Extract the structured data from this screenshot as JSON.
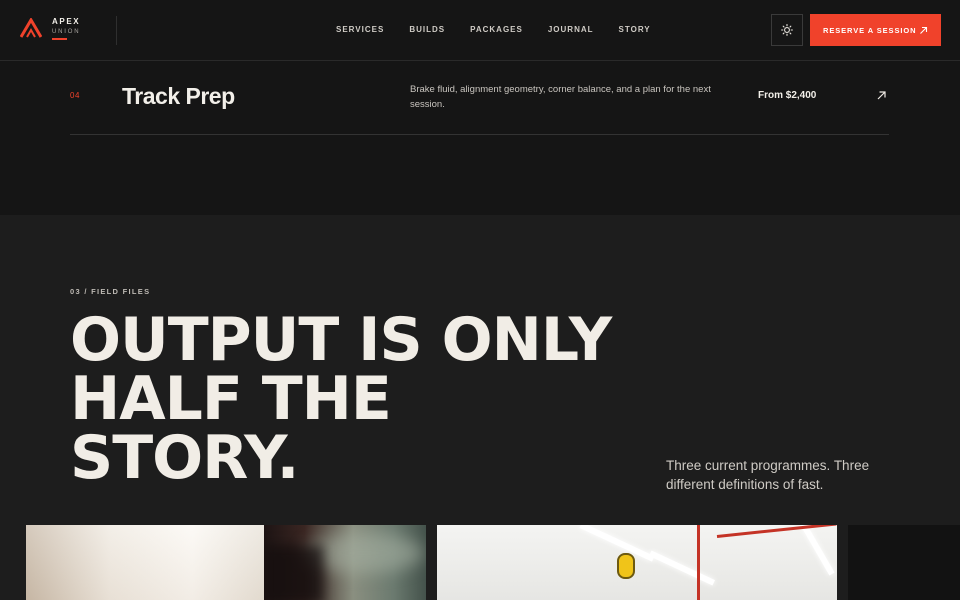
{
  "brand": {
    "name": "APEX",
    "sub": "UNION",
    "accent": "#f0422b"
  },
  "nav": {
    "items": [
      "SERVICES",
      "BUILDS",
      "PACKAGES",
      "JOURNAL",
      "STORY"
    ]
  },
  "header": {
    "theme_icon": "sun-icon",
    "cta_label": "RESERVE A SESSION",
    "cta_icon": "arrow-up-right-icon"
  },
  "service_row": {
    "number": "04",
    "title": "Track Prep",
    "description": "Brake fluid, alignment geometry, corner balance, and a plan for the next session.",
    "price": "From $2,400",
    "icon": "arrow-up-right-icon"
  },
  "section": {
    "eyebrow": "03 / FIELD FILES",
    "headline_lines": [
      "OUTPUT IS ONLY",
      "HALF THE",
      "STORY."
    ],
    "subtext": "Three current programmes. Three different definitions of fast."
  },
  "colors": {
    "background": "#151515",
    "section_background": "#1d1d1d",
    "text": "#f1ede6"
  }
}
